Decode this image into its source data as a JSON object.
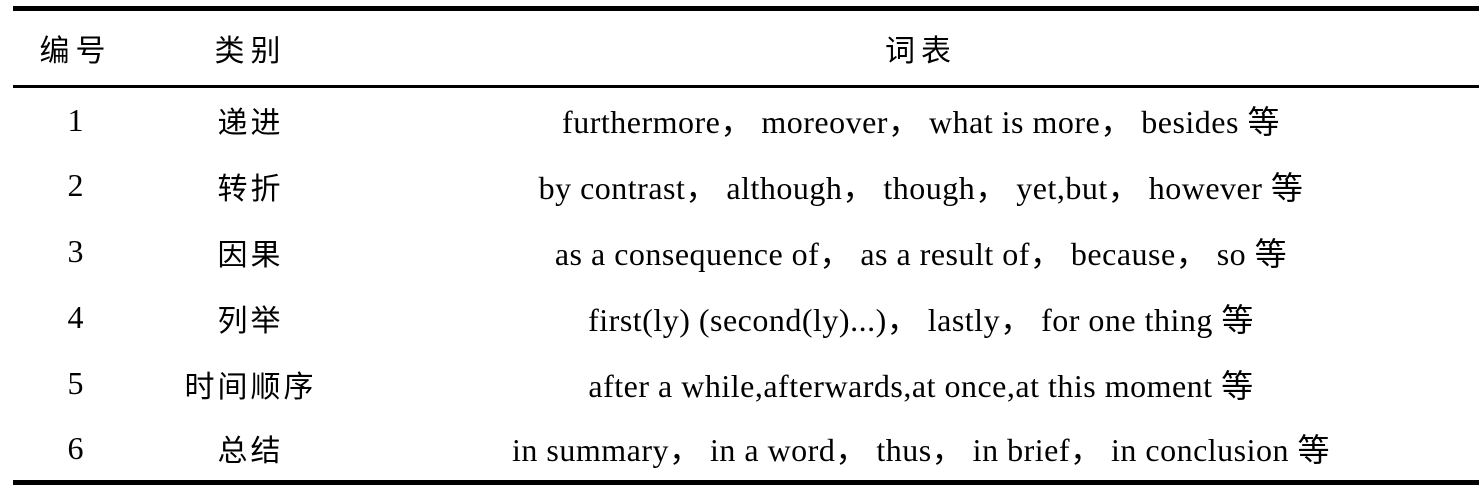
{
  "table": {
    "headers": [
      "编号",
      "类别",
      "词表"
    ],
    "rows": [
      {
        "num": "1",
        "category": "递进",
        "words": "furthermore， moreover， what is more， besides 等"
      },
      {
        "num": "2",
        "category": "转折",
        "words": "by contrast， although， though， yet,but， however 等"
      },
      {
        "num": "3",
        "category": "因果",
        "words": "as a consequence of， as a result of， because， so 等"
      },
      {
        "num": "4",
        "category": "列举",
        "words": "first(ly) (second(ly)...)， lastly， for one thing 等"
      },
      {
        "num": "5",
        "category": "时间顺序",
        "words": "after a while,afterwards,at once,at this moment 等"
      },
      {
        "num": "6",
        "category": "总结",
        "words": "in summary， in a word， thus， in brief，  in conclusion 等"
      }
    ]
  }
}
